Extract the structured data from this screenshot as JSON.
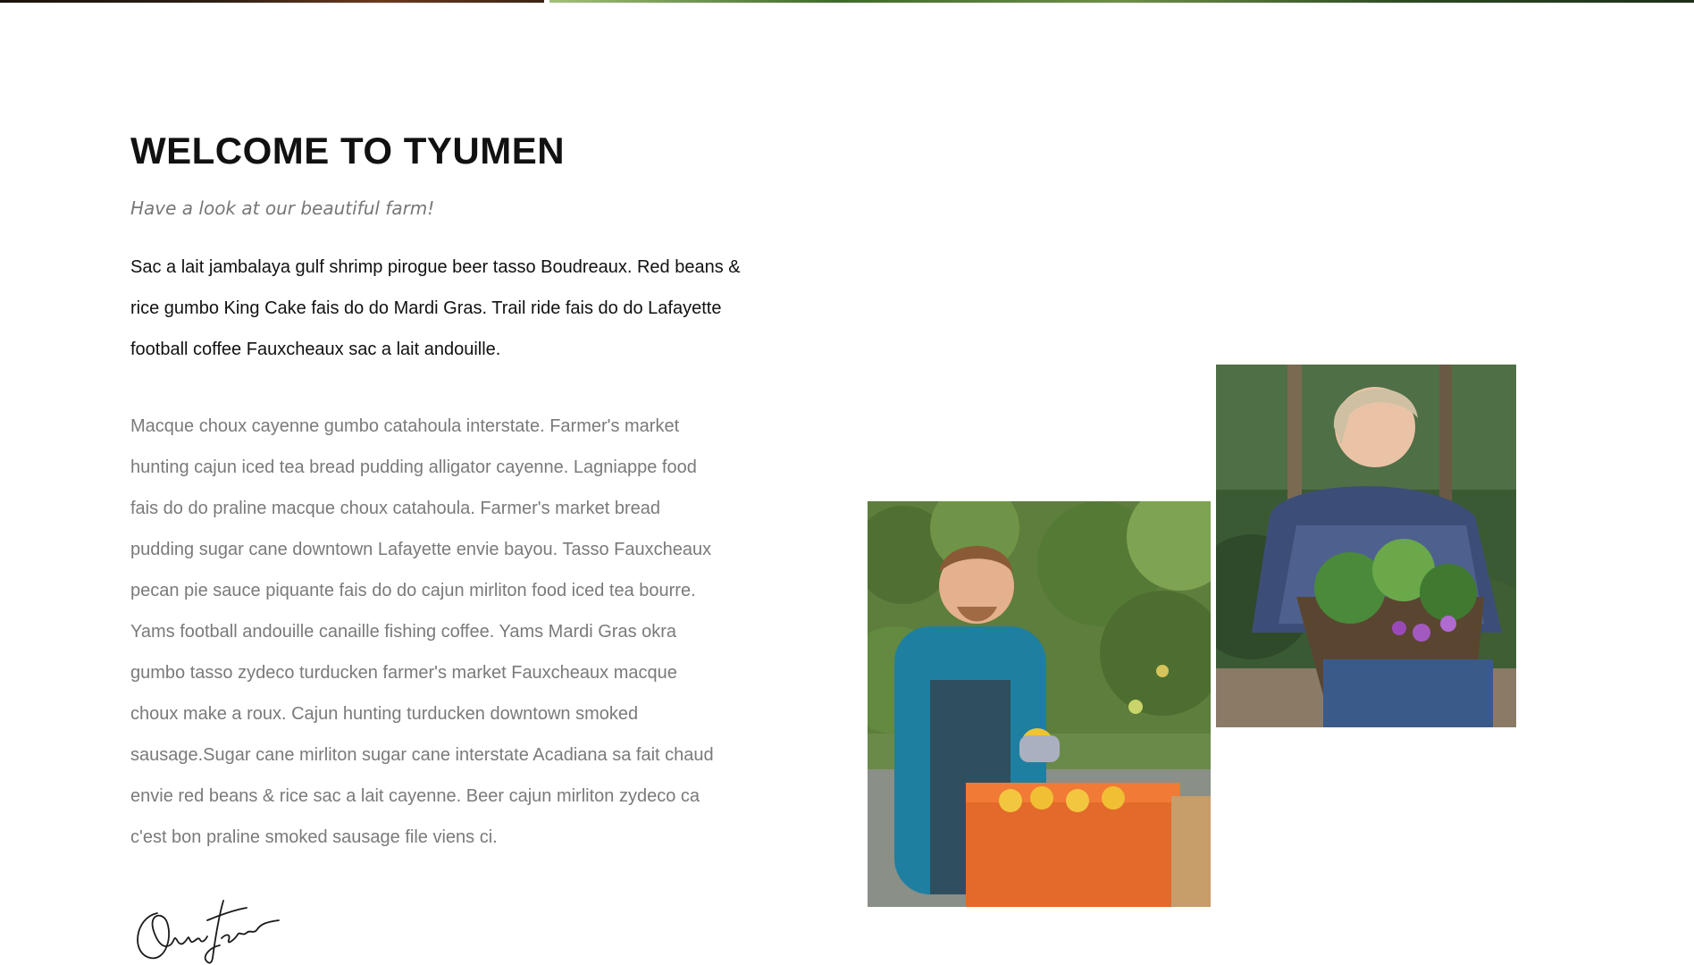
{
  "header": {
    "title": "WELCOME TO TYUMEN",
    "subtitle": "Have a look at our beautiful farm!"
  },
  "intro": {
    "lead": "Sac a lait jambalaya gulf shrimp pirogue beer tasso Boudreaux. Red beans & rice gumbo King Cake fais do do Mardi Gras. Trail ride fais do do Lafayette football coffee Fauxcheaux sac a lait andouille.",
    "body": "Macque choux cayenne gumbo catahoula interstate. Farmer's market hunting cajun iced tea bread pudding alligator cayenne. Lagniappe food fais do do praline macque choux catahoula. Farmer's market bread pudding sugar cane downtown Lafayette envie bayou. Tasso Fauxcheaux pecan pie sauce piquante fais do do cajun mirliton food iced tea bourre. Yams football andouille canaille fishing coffee. Yams Mardi Gras okra gumbo tasso zydeco turducken farmer's market Fauxcheaux macque choux make a roux. Cajun hunting turducken downtown smoked sausage.Sugar cane mirliton sugar cane interstate Acadiana sa fait chaud envie red beans & rice sac a lait cayenne. Beer cajun mirliton zydeco ca c'est bon praline smoked sausage file viens ci."
  },
  "images": {
    "farmer_man": "photo-farmer-with-crate",
    "farmer_woman": "photo-farmer-with-basket"
  },
  "colors": {
    "heading": "#111111",
    "muted": "#7a7a7a",
    "background": "#ffffff"
  }
}
